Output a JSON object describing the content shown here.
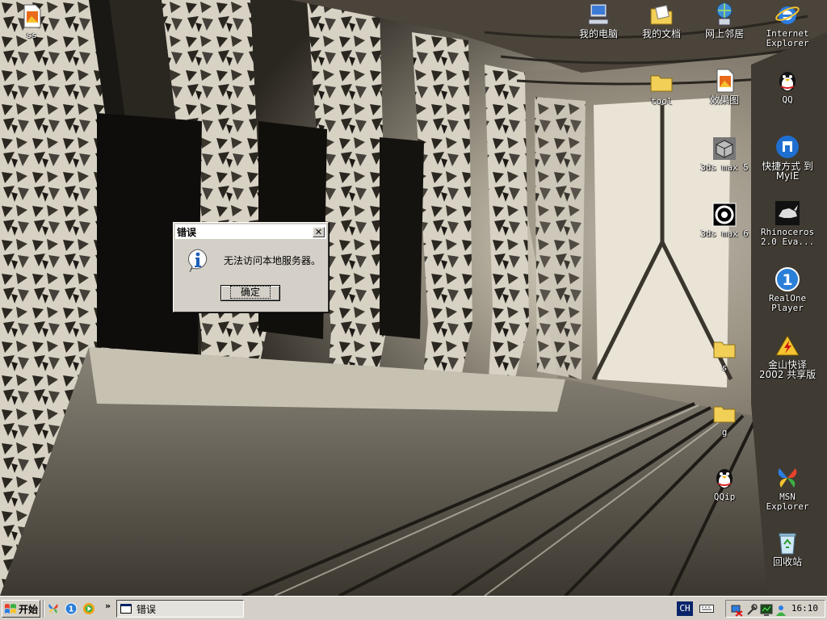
{
  "desktop": {
    "icons": [
      {
        "id": "ss",
        "label": "ss",
        "icon": "image-file-icon"
      },
      {
        "id": "my-computer",
        "label": "我的电脑",
        "icon": "computer-icon"
      },
      {
        "id": "my-documents",
        "label": "我的文档",
        "icon": "documents-folder-icon"
      },
      {
        "id": "network",
        "label": "网上邻居",
        "icon": "network-icon"
      },
      {
        "id": "ie",
        "label": "Internet Explorer",
        "icon": "internet-explorer-icon"
      },
      {
        "id": "tool",
        "label": "tool",
        "icon": "folder-icon"
      },
      {
        "id": "effect",
        "label": "效果图",
        "icon": "image-file-icon"
      },
      {
        "id": "qq",
        "label": "QQ",
        "icon": "qq-penguin-icon"
      },
      {
        "id": "3dsmax5",
        "label": "3ds max 5",
        "icon": "3dsmax-icon"
      },
      {
        "id": "myie",
        "label": "快捷方式 到 MyIE",
        "icon": "myie-icon"
      },
      {
        "id": "3dsmax6",
        "label": "3ds max 6",
        "icon": "3dsmax6-icon"
      },
      {
        "id": "rhino",
        "label": "Rhinoceros 2.0 Eva...",
        "icon": "rhino-icon"
      },
      {
        "id": "realone",
        "label": "RealOne Player",
        "icon": "realone-icon"
      },
      {
        "id": "s",
        "label": "s",
        "icon": "folder-icon"
      },
      {
        "id": "kingsoft",
        "label": "金山快译 2002 共享版",
        "icon": "kingsoft-icon"
      },
      {
        "id": "g",
        "label": "g",
        "icon": "folder-icon"
      },
      {
        "id": "qqip",
        "label": "QQip",
        "icon": "qq-penguin-icon"
      },
      {
        "id": "msn",
        "label": "MSN Explorer",
        "icon": "msn-butterfly-icon"
      },
      {
        "id": "recycle",
        "label": "回收站",
        "icon": "recycle-bin-icon"
      }
    ]
  },
  "dialog": {
    "title": "错误",
    "close_label": "✕",
    "message": "无法访问本地服务器。",
    "ok_label": "确定",
    "icon": "info-icon"
  },
  "taskbar": {
    "start_label": "开始",
    "chevron": "»",
    "task_label": "错误",
    "lang": "CH",
    "clock": "16:10",
    "quicklaunch": [
      "msn-butterfly-icon",
      "realone-icon",
      "media-player-icon"
    ],
    "tray": [
      "network-disconnected-icon",
      "tool-icon",
      "monitor-icon",
      "network-user-icon"
    ]
  },
  "colors": {
    "dialog_face": "#d4d0c8",
    "titlebar": "#ffffff",
    "lang_badge": "#0a246a",
    "info_icon": "#1e5fb8"
  }
}
